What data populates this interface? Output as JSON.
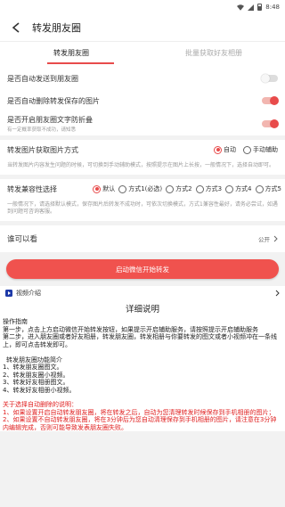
{
  "status": {
    "time": "8:48"
  },
  "appbar": {
    "title": "转发朋友圈"
  },
  "tabs": [
    {
      "label": "转发朋友圈"
    },
    {
      "label": "批量获取好友相册"
    }
  ],
  "settings": {
    "auto_send": {
      "label": "是否自动发送到朋友圈",
      "on": false
    },
    "auto_delete": {
      "label": "是否自动删除转发保存的图片",
      "on": true
    },
    "anti_fold": {
      "label": "是否开启朋友圈文字防折叠",
      "sub": "有一定概率获取不成功，请知悉",
      "on": true
    }
  },
  "image_mode": {
    "label": "转发图片获取图片方式",
    "options": [
      "自动",
      "手动辅助"
    ],
    "selected": "自动",
    "desc": "当转发图片内容发生问题的时候，可切换到手动辅助模式，按照提示在图片上长按，一般情况下，选择自动即可。"
  },
  "compat_mode": {
    "label": "转发兼容性选择",
    "options": [
      "默认",
      "方式1(必选)",
      "方式2",
      "方式3",
      "方式4",
      "方式5"
    ],
    "selected": "默认",
    "desc": "一般情况下，请选择默认模式，保存图片后转发不成功时，可依次切换模式，方式1兼容性最好，请务必尝试，如遇到问题可咨询客服。"
  },
  "visibility": {
    "label": "谁可以看",
    "value": "公开"
  },
  "start_button": {
    "label": "启动微信开始转发"
  },
  "video": {
    "label": "视频介绍"
  },
  "detail": {
    "title": "详细说明",
    "guide_lines": [
      "操作指南",
      "第一步，点击上方启动微信开始转发按钮，如果提示开启辅助服务，请按照提示开启辅助服务",
      "第二步，进入朋友圈或者好友相册，转发朋友圈，转发相册与你要转发的图文或者小视频冲在一条线上，即可点击转发即可。",
      "",
      "转发朋友圈功能简介",
      "1、转发朋友圈图文。",
      "2、转发朋友圈小视频。",
      "3、转发好友相册图文。",
      "4、转发好友相册小视频。"
    ],
    "warning_lines": [
      "关于选择自动删除的说明：",
      "1、如果设置开启自动转发朋友圈，将在转发之后，自动为您清理转发时候保存到手机相册的图片；",
      "2、如果设置不自动转发朋友圈，将在3分钟后为您自动清理保存到手机相册的图片，请注意在3分钟内编辑完成，否则可能导致发表朋友圈失败。"
    ]
  },
  "colors": {
    "accent": "#e84b4b",
    "button": "#f0524e",
    "warning": "#e02020"
  }
}
